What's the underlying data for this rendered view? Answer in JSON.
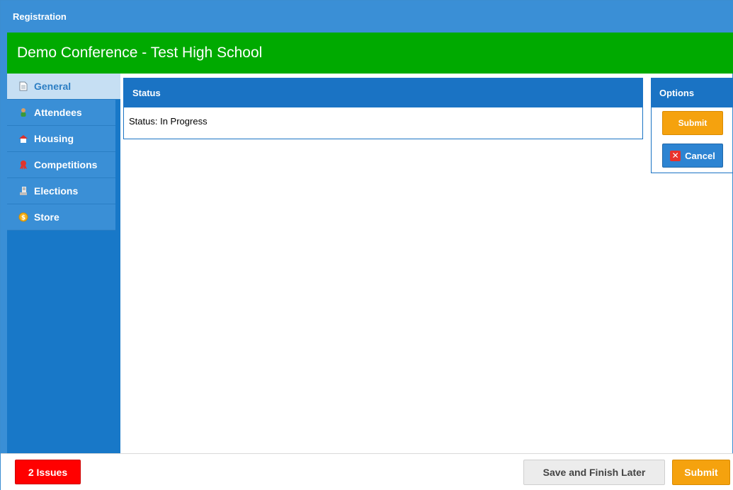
{
  "window": {
    "title": "Registration"
  },
  "banner": {
    "title": "Demo Conference - Test High School"
  },
  "sidebar": {
    "items": [
      {
        "label": "General",
        "icon": "document-icon",
        "active": true
      },
      {
        "label": "Attendees",
        "icon": "person-icon",
        "active": false
      },
      {
        "label": "Housing",
        "icon": "house-icon",
        "active": false
      },
      {
        "label": "Competitions",
        "icon": "ribbon-icon",
        "active": false
      },
      {
        "label": "Elections",
        "icon": "ballot-icon",
        "active": false
      },
      {
        "label": "Store",
        "icon": "coin-icon",
        "active": false
      }
    ]
  },
  "status_panel": {
    "header": "Status",
    "status_label": "Status:",
    "status_value": "In Progress"
  },
  "options_panel": {
    "header": "Options",
    "submit_label": "Submit",
    "cancel_label": "Cancel"
  },
  "footer": {
    "issues_label": "2 Issues",
    "save_later_label": "Save and Finish Later",
    "submit_label": "Submit"
  },
  "colors": {
    "title_blue": "#3a8fd6",
    "banner_green": "#00aa00",
    "panel_blue": "#1a73c4",
    "submit_orange": "#f5a20e",
    "issues_red": "#ff0000"
  }
}
